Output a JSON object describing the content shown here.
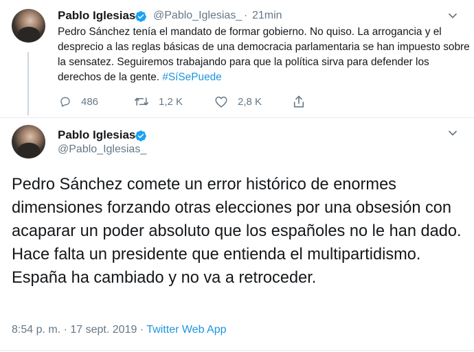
{
  "colors": {
    "text": "#14171a",
    "muted": "#657786",
    "link": "#1b95e0",
    "divider": "#e6ecf0"
  },
  "tweet1": {
    "author_name": "Pablo Iglesias",
    "handle": "@Pablo_Iglesias_",
    "separator": "·",
    "time": "21min",
    "text": "Pedro Sánchez tenía el mandato de formar gobierno. No quiso. La arrogancia y el desprecio a las reglas básicas de una democracia parlamentaria se han impuesto sobre la sensatez. Seguiremos trabajando para que la política sirva para defender los derechos de la gente.",
    "hashtag": "#SíSePuede",
    "reply_count": "486",
    "retweet_count": "1,2 K",
    "like_count": "2,8 K",
    "icons": [
      "reply-icon",
      "retweet-icon",
      "like-icon",
      "share-icon",
      "verified-badge-icon",
      "chevron-down-icon"
    ]
  },
  "tweet2": {
    "author_name": "Pablo Iglesias",
    "handle": "@Pablo_Iglesias_",
    "text": "Pedro Sánchez comete un error histórico de enormes dimensiones forzando otras elecciones por una obsesión con acaparar un poder absoluto que los españoles no le han dado. Hace falta un presidente que entienda el multipartidismo. España ha cambiado y no va a retroceder.",
    "time": "8:54 p. m.",
    "separator": "·",
    "date": "17 sept. 2019",
    "client": "Twitter Web App"
  }
}
